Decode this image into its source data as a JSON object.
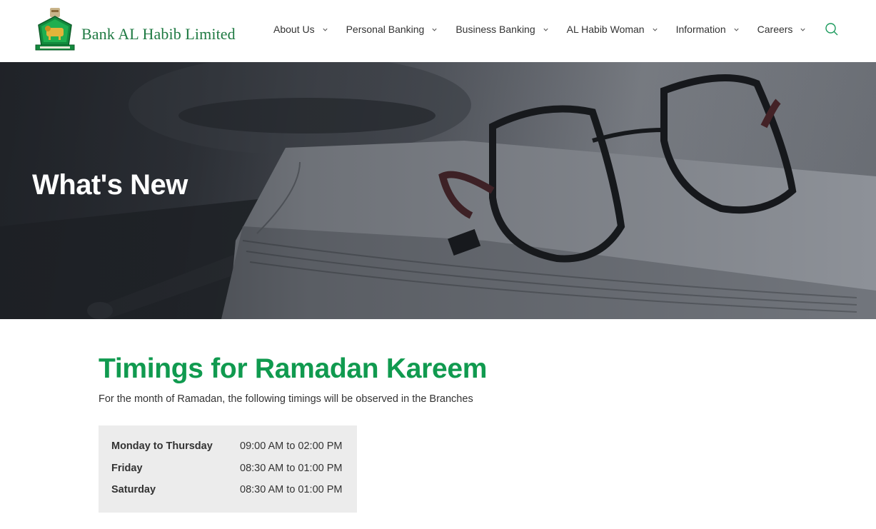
{
  "header": {
    "logo_text": "Bank AL Habib Limited",
    "brand_color": "#1f7a43",
    "nav_items": [
      {
        "label": "About Us",
        "icon": "chevron-down-icon"
      },
      {
        "label": "Personal Banking",
        "icon": "chevron-down-icon"
      },
      {
        "label": "Business Banking",
        "icon": "chevron-down-icon"
      },
      {
        "label": "AL Habib Woman",
        "icon": "chevron-down-icon"
      },
      {
        "label": "Information",
        "icon": "chevron-down-icon"
      },
      {
        "label": "Careers",
        "icon": "chevron-down-icon"
      }
    ],
    "search_icon": "search-icon"
  },
  "hero": {
    "title": "What's New"
  },
  "main": {
    "heading": "Timings for Ramadan Kareem",
    "heading_color": "#109a4f",
    "intro": "For the month of Ramadan, the following timings will be observed in the Branches",
    "timings": [
      {
        "day": "Monday to Thursday",
        "hours": "09:00 AM to 02:00 PM"
      },
      {
        "day": "Friday",
        "hours": "08:30 AM to 01:00 PM"
      },
      {
        "day": "Saturday",
        "hours": "08:30 AM to 01:00 PM"
      }
    ]
  }
}
